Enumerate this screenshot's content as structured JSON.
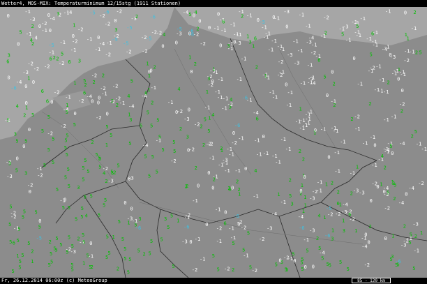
{
  "header": {
    "title": "Wetter4, MOS-MIX: Temperaturminimum 12/15stg (1911 Stationen)"
  },
  "footer": {
    "credit": "Fr, 26.12.2014 06:00z (c) MeteoGroup",
    "scale_label": "85 - 120 km"
  },
  "map": {
    "colors": {
      "land": "#8c8c8c",
      "sea": "#a6a6a6",
      "border": "#2a2a2a",
      "positive_value": "#00c000",
      "zero_value": "#ffffff",
      "negative_value": "#ffffff",
      "cold_value": "#40c0e0"
    },
    "station_values": [
      {
        "v": "5",
        "c": "g"
      },
      {
        "v": "6",
        "c": "g"
      },
      {
        "v": "2",
        "c": "g"
      },
      {
        "v": "-1",
        "c": "w"
      },
      {
        "v": "-2",
        "c": "w"
      },
      {
        "v": "0",
        "c": "w"
      },
      {
        "v": "-3",
        "c": "w"
      },
      {
        "v": "1",
        "c": "g"
      },
      {
        "v": "3",
        "c": "g"
      },
      {
        "v": "-1",
        "c": "w"
      },
      {
        "v": "0",
        "c": "w"
      },
      {
        "v": "2",
        "c": "g"
      },
      {
        "v": "-2",
        "c": "w"
      },
      {
        "v": "-4",
        "c": "w"
      },
      {
        "v": "1",
        "c": "g"
      },
      {
        "v": "4",
        "c": "g"
      },
      {
        "v": "0",
        "c": "w"
      },
      {
        "v": "-1",
        "c": "w"
      },
      {
        "v": "-3",
        "c": "w"
      },
      {
        "v": "2",
        "c": "g"
      },
      {
        "v": "-5",
        "c": "c"
      },
      {
        "v": "0",
        "c": "w"
      },
      {
        "v": "1",
        "c": "g"
      },
      {
        "v": "-2",
        "c": "w"
      },
      {
        "v": "3",
        "c": "g"
      },
      {
        "v": "-1",
        "c": "w"
      },
      {
        "v": "0",
        "c": "w"
      },
      {
        "v": "-4",
        "c": "w"
      },
      {
        "v": "2",
        "c": "g"
      },
      {
        "v": "-6",
        "c": "c"
      }
    ]
  }
}
